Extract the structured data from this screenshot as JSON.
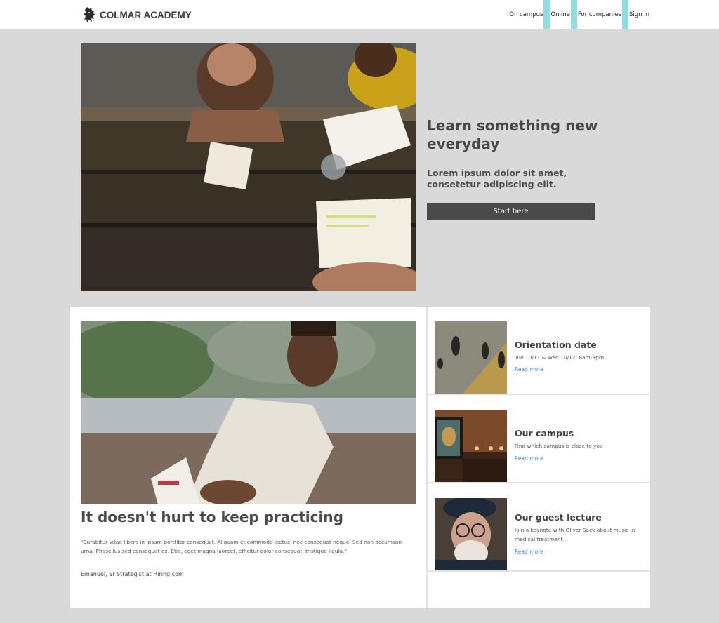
{
  "header": {
    "logo_text": "COLMAR ACADEMY",
    "nav": [
      "On campus",
      "Online",
      "For companies",
      "Sign in"
    ]
  },
  "hero": {
    "title": "Learn something new everyday",
    "subtitle": "Lorem ipsum dolor sit amet, consetetur adipiscing elit.",
    "button_label": "Start here",
    "image_alt": "students-reading-at-table"
  },
  "feature": {
    "title": "It doesn't hurt to keep practicing",
    "quote": "\"Curabitur vitae libero in ipsum porttitor consequat. Aliquam et commodo lectus, nec consequat neque. Sed non accumsan urna. Phasellus sed consequat ex. Etia, eget magna laoreet, efficitur dolor consequat, tristique ligula.\"",
    "author": "Emanuel, Sr Strategist at Hiring.com"
  },
  "cards": [
    {
      "title": "Orientation date",
      "desc": "Tue 10/11 & Wed 10/12: 8am-3pm",
      "link": "Read more"
    },
    {
      "title": "Our campus",
      "desc": "Find which campus is close to you",
      "link": "Read more"
    },
    {
      "title": "Our guest lecture",
      "desc": "Join a keynote with Oliver Sack about music in medical treatment",
      "link": "Read more"
    }
  ],
  "colors": {
    "accent": "#8fdede",
    "button": "#4a4a4a",
    "link": "#3f8ad0",
    "page_bg": "#d9d9d9"
  }
}
